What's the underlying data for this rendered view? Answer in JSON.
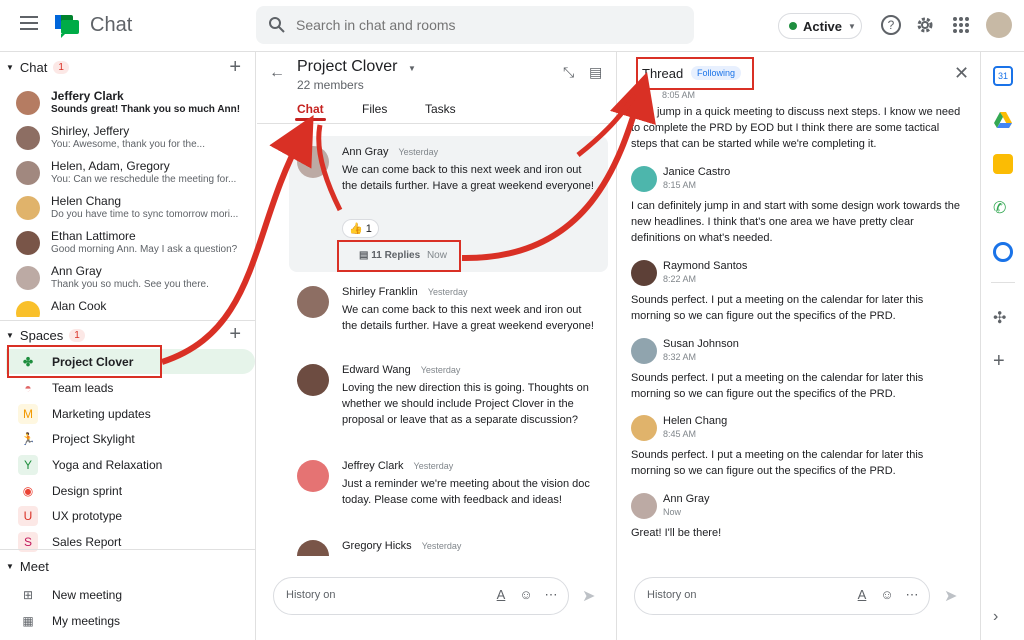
{
  "app": {
    "title": "Chat"
  },
  "search": {
    "placeholder": "Search in chat and rooms"
  },
  "status": {
    "label": "Active"
  },
  "sidebar": {
    "chat_section": {
      "label": "Chat",
      "badge": "1"
    },
    "dms": [
      {
        "name": "Jeffery Clark",
        "preview": "Sounds great! Thank you so much Ann!",
        "unread": true
      },
      {
        "name": "Shirley, Jeffery",
        "preview": "You: Awesome, thank you for the..."
      },
      {
        "name": "Helen, Adam, Gregory",
        "preview": "You: Can we reschedule the meeting for..."
      },
      {
        "name": "Helen Chang",
        "preview": "Do you have time to sync tomorrow mori..."
      },
      {
        "name": "Ethan Lattimore",
        "preview": "Good morning Ann. May I ask a question?"
      },
      {
        "name": "Ann Gray",
        "preview": "Thank you so much. See you there."
      },
      {
        "name": "Alan Cook",
        "preview": ""
      }
    ],
    "spaces_section": {
      "label": "Spaces",
      "badge": "1"
    },
    "spaces": [
      {
        "label": "Project Clover",
        "icon": "clover-icon",
        "letter": ""
      },
      {
        "label": "Team leads",
        "icon": "watermelon-icon",
        "letter": ""
      },
      {
        "label": "Marketing updates",
        "icon": "letter-m",
        "letter": "M"
      },
      {
        "label": "Project Skylight",
        "icon": "runner-icon",
        "letter": ""
      },
      {
        "label": "Yoga and Relaxation",
        "icon": "letter-y",
        "letter": "Y"
      },
      {
        "label": "Design sprint",
        "icon": "magnifier-icon",
        "letter": ""
      },
      {
        "label": "UX prototype",
        "icon": "letter-u",
        "letter": "U"
      },
      {
        "label": "Sales Report",
        "icon": "letter-s",
        "letter": "S"
      }
    ],
    "meet_section": {
      "label": "Meet"
    },
    "meet_items": [
      {
        "label": "New meeting"
      },
      {
        "label": "My meetings"
      }
    ]
  },
  "room": {
    "title": "Project Clover",
    "members": "22 members",
    "tabs": [
      {
        "label": "Chat"
      },
      {
        "label": "Files"
      },
      {
        "label": "Tasks"
      }
    ],
    "messages": [
      {
        "name": "Ann Gray",
        "time": "Yesterday",
        "text": "We can come back to this next week and iron out the details further. Have a great weekend everyone!",
        "reaction": "👍 1",
        "replies": "11 Replies",
        "replies_time": "Now"
      },
      {
        "name": "Shirley Franklin",
        "time": "Yesterday",
        "text": "We can come back to this next week and iron out the details further. Have a great weekend everyone!"
      },
      {
        "name": "Edward Wang",
        "time": "Yesterday",
        "text": "Loving the new direction this is going. Thoughts on whether we should include Project Clover in the proposal or leave that as a separate discussion?"
      },
      {
        "name": "Jeffrey Clark",
        "time": "Yesterday",
        "text": "Just a reminder we're meeting about the vision doc today. Please come with feedback and ideas!"
      },
      {
        "name": "Gregory Hicks",
        "time": "Yesterday",
        "text": ""
      }
    ],
    "compose": {
      "placeholder": "History on"
    }
  },
  "thread": {
    "title": "Thread",
    "following": "Following",
    "top_time": "8:05 AM",
    "top_text": "Let's jump in a quick meeting to discuss next steps. I know we need to complete the PRD by EOD but I think there are some tactical steps that can be started while we're completing it.",
    "messages": [
      {
        "name": "Janice Castro",
        "time": "8:15 AM",
        "text": "I can definitely jump in and start with some design work towards the new headlines. I think that's one area we have pretty clear definitions on what's needed."
      },
      {
        "name": "Raymond Santos",
        "time": "8:22 AM",
        "text": "Sounds perfect. I put a meeting on the calendar for later this morning so we can figure out the specifics of the PRD."
      },
      {
        "name": "Susan Johnson",
        "time": "8:32 AM",
        "text": "Sounds perfect. I put a meeting on the calendar for later this morning so we can figure out the specifics of the PRD."
      },
      {
        "name": "Helen Chang",
        "time": "8:45 AM",
        "text": "Sounds perfect. I put a meeting on the calendar for later this morning so we can figure out the specifics of the PRD."
      },
      {
        "name": "Ann Gray",
        "time": "Now",
        "text": "Great! I'll be there!"
      }
    ],
    "compose": {
      "placeholder": "History on"
    }
  },
  "colors": {
    "accent": "#c5221f",
    "annotation": "#d93025",
    "active_space": "#e6f4ea"
  }
}
